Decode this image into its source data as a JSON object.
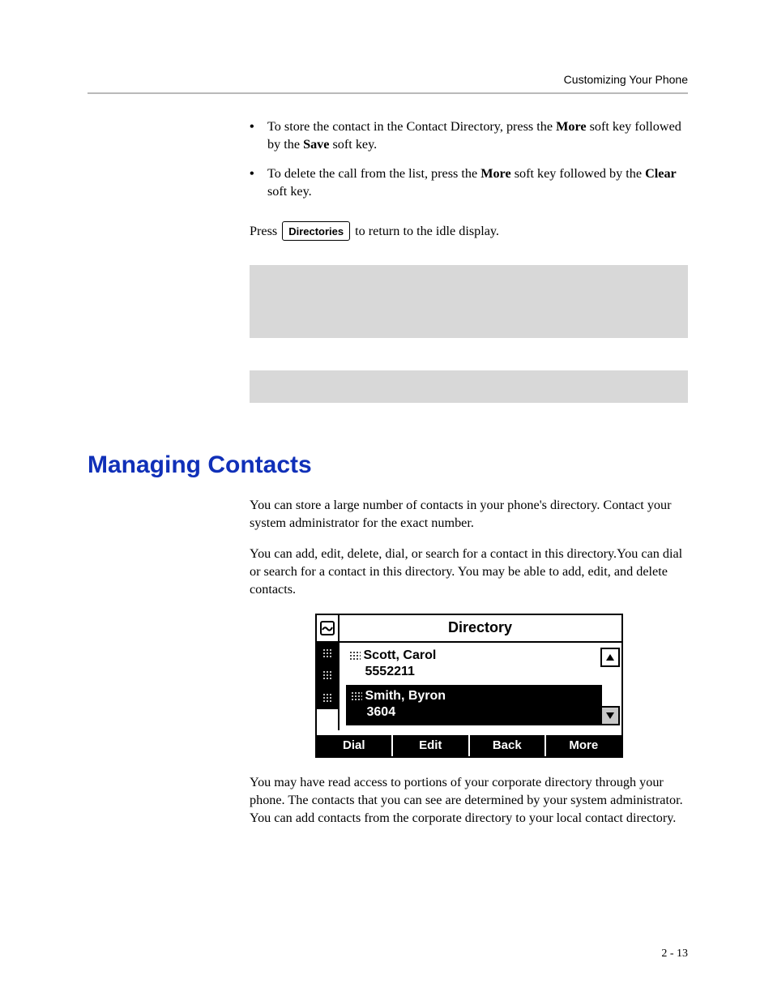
{
  "header": {
    "section": "Customizing Your Phone"
  },
  "bullets": [
    {
      "pre": "To store the contact in the Contact Directory, press the ",
      "b1": "More",
      "mid": " soft key followed by the ",
      "b2": "Save",
      "post": " soft key."
    },
    {
      "pre": "To delete the call from the list, press the ",
      "b1": "More",
      "mid": " soft key followed by the ",
      "b2": "Clear",
      "post": " soft key."
    }
  ],
  "press_line": {
    "pre": "Press ",
    "button": "Directories",
    "post": " to return to the idle display."
  },
  "section_title": "Managing Contacts",
  "paras": {
    "p1": "You can store a large number of contacts in your phone's directory. Contact your system administrator for the exact number.",
    "p2": "You can add, edit, delete, dial, or search for a contact in this directory.You can dial or search for a contact in this directory. You may be able to add, edit, and delete contacts.",
    "p3": "You may have read access to portions of your corporate directory through your phone. The contacts that you can see are determined by your system administrator. You can add contacts from the corporate directory to your local contact directory."
  },
  "phone": {
    "title": "Directory",
    "entries": [
      {
        "name": "Scott, Carol",
        "number": "5552211",
        "selected": false
      },
      {
        "name": "Smith, Byron",
        "number": "3604",
        "selected": true
      }
    ],
    "softkeys": [
      "Dial",
      "Edit",
      "Back",
      "More"
    ]
  },
  "page_number": "2 - 13"
}
